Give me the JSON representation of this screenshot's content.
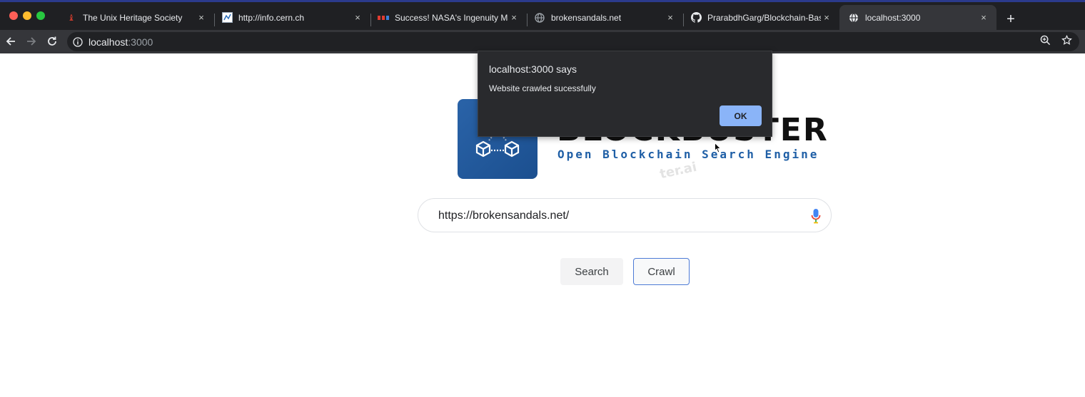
{
  "browser": {
    "tabs": [
      {
        "title": "The Unix Heritage Society",
        "icon": "unix-heritage-favicon",
        "active": false
      },
      {
        "title": "http://info.cern.ch",
        "icon": "cern-favicon",
        "active": false
      },
      {
        "title": "Success! NASA's Ingenuity Ma",
        "icon": "nasa-favicon",
        "active": false
      },
      {
        "title": "brokensandals.net",
        "icon": "globe-icon",
        "active": false
      },
      {
        "title": "PrarabdhGarg/Blockchain-Bas",
        "icon": "github-icon",
        "active": false
      },
      {
        "title": "localhost:3000",
        "icon": "globe-icon",
        "active": true
      }
    ],
    "new_tab_label": "+",
    "close_glyph": "×",
    "address": {
      "host": "localhost",
      "port": ":3000"
    }
  },
  "page": {
    "logo_word": "BLOCKBUSTER",
    "logo_tagline": "Open Blockchain Search Engine",
    "logo_watermark": "ter.ai",
    "search_value": "https://brokensandals.net/",
    "search_button": "Search",
    "crawl_button": "Crawl"
  },
  "dialog": {
    "title": "localhost:3000 says",
    "message": "Website crawled sucessfully",
    "ok_label": "OK"
  },
  "colors": {
    "dialog_bg": "#292a2d",
    "ok_button": "#8ab4f8",
    "crawl_border": "#4d7bd6",
    "logo_blue": "#1f5fa6"
  }
}
